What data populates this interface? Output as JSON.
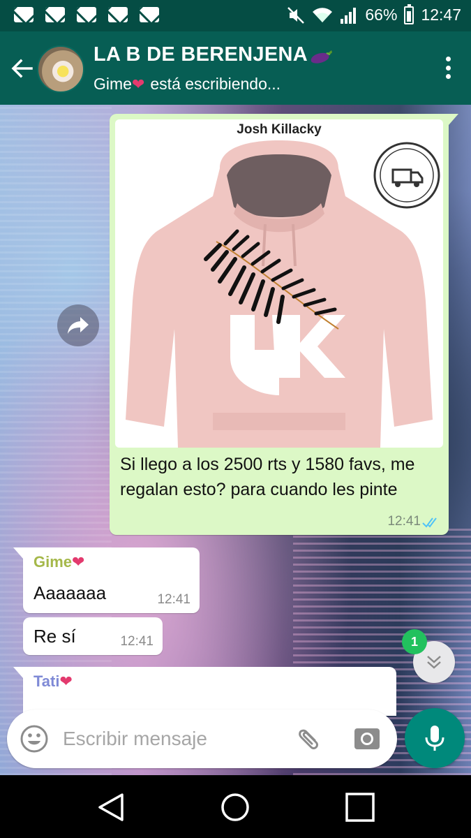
{
  "status_bar": {
    "mail_icons": [
      "mail-icon",
      "mail-icon",
      "mail-icon",
      "mail-icon",
      "mail-icon"
    ],
    "battery": "66%",
    "time": "12:47"
  },
  "header": {
    "title": "LA B DE BERENJENA",
    "title_emoji": "eggplant-icon",
    "subtitle_name": "Gime",
    "subtitle_emoji": "sparkling-heart-icon",
    "subtitle_status": "está escribiendo..."
  },
  "messages": [
    {
      "type": "outgoing-image",
      "image_caption": "Josh Killacky",
      "text": "Si llego a los 2500 rts y 1580 favs, me regalan esto? para cuando les pinte",
      "time": "12:41",
      "status": "read"
    },
    {
      "type": "incoming",
      "sender": "Gime",
      "text": "Aaaaaaa",
      "time": "12:41"
    },
    {
      "type": "incoming",
      "text": "Re sí",
      "time": "12:41"
    },
    {
      "type": "incoming",
      "sender": "Tati",
      "text": "",
      "time": ""
    }
  ],
  "scroll_badge": "1",
  "composer": {
    "placeholder": "Escribir mensaje"
  },
  "colors": {
    "header": "#075e54",
    "status_bar": "#054d44",
    "outgoing_bubble": "#dcf8c6",
    "incoming_bubble": "#ffffff",
    "accent": "#00897b",
    "sender_gime": "#a5b84a",
    "sender_tati": "#7f8ad6",
    "read_ticks": "#4fc3f7"
  }
}
